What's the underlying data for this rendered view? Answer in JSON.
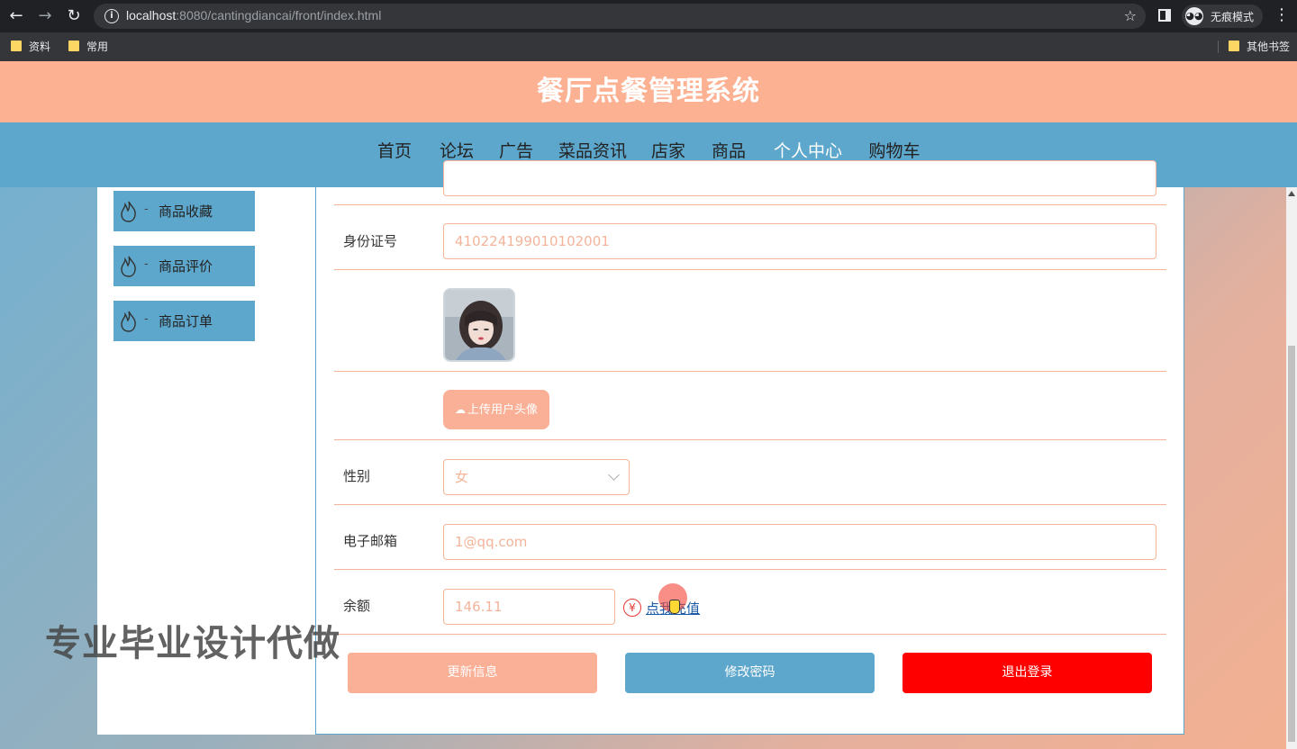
{
  "browser": {
    "url_host": "localhost",
    "url_rest": ":8080/cantingdiancai/front/index.html",
    "incognito_label": "无痕模式",
    "bookmarks": [
      "资料",
      "常用"
    ],
    "other_bookmarks": "其他书签"
  },
  "site": {
    "title": "餐厅点餐管理系统",
    "nav": [
      {
        "label": "首页"
      },
      {
        "label": "论坛"
      },
      {
        "label": "广告"
      },
      {
        "label": "菜品资讯"
      },
      {
        "label": "店家"
      },
      {
        "label": "商品"
      },
      {
        "label": "个人中心",
        "active": true
      },
      {
        "label": "购物车"
      }
    ]
  },
  "sidebar": {
    "items": [
      {
        "label": "商品收藏"
      },
      {
        "label": "商品评价"
      },
      {
        "label": "商品订单"
      }
    ]
  },
  "form": {
    "id_label": "身份证号",
    "id_value": "410224199010102001",
    "upload_label": "上传用户头像",
    "gender_label": "性别",
    "gender_value": "女",
    "email_label": "电子邮箱",
    "email_value": "1@qq.com",
    "balance_label": "余额",
    "balance_value": "146.11",
    "yen_symbol": "¥",
    "recharge_label": "点我充值"
  },
  "buttons": {
    "update": "更新信息",
    "change_password": "修改密码",
    "logout": "退出登录"
  },
  "colors": {
    "header": "#fbb192",
    "nav": "#5ea7cc",
    "update_btn": "#f9b096",
    "password_btn": "#5ea7cc",
    "logout_btn": "#ff0000"
  },
  "watermark": "专业毕业设计代做"
}
